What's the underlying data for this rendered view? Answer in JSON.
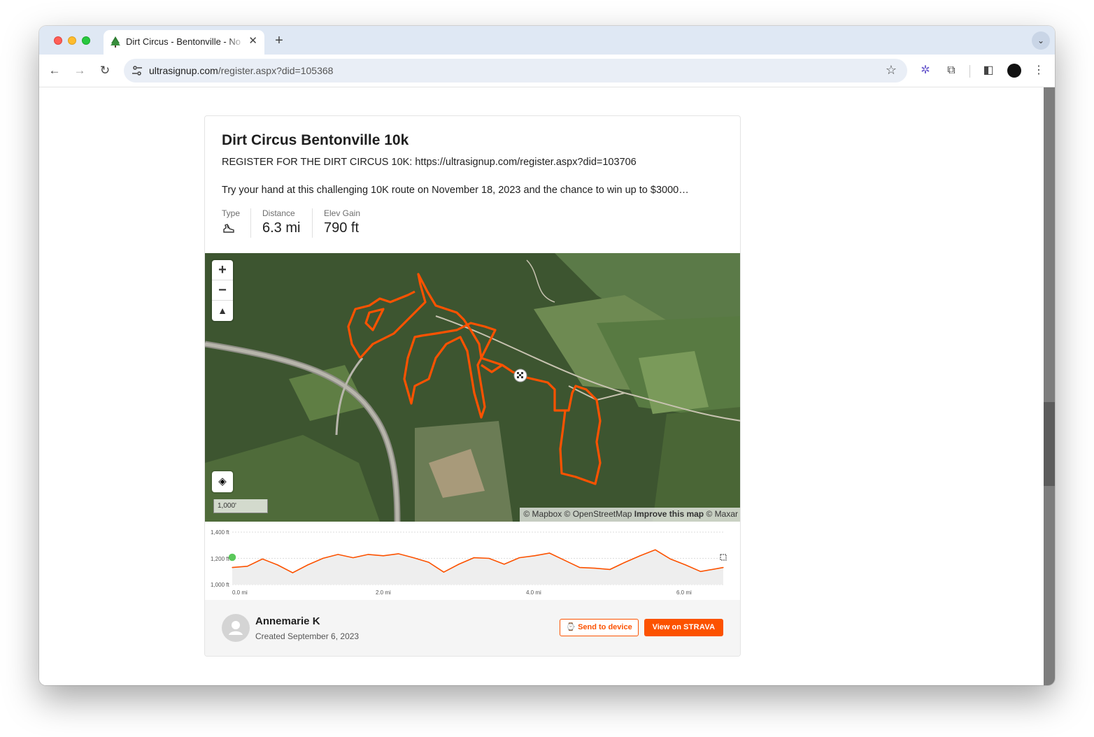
{
  "browser": {
    "tab_title": "Dirt Circus - Bentonville - No",
    "tab_close": "✕",
    "new_tab": "+",
    "tab_menu": "⌄",
    "url_domain": "ultrasignup.com",
    "url_path": "/register.aspx?did=105368",
    "icons": [
      "back-icon",
      "forward-icon",
      "reload-icon",
      "site-settings-icon",
      "bookmark-star-icon",
      "extension-puzzle-icon",
      "sidebar-icon",
      "profile-avatar",
      "more-menu-icon"
    ]
  },
  "route": {
    "title": "Dirt Circus Bentonville 10k",
    "register_line": "REGISTER FOR THE DIRT CIRCUS 10K: https://ultrasignup.com/register.aspx?did=103706",
    "description": "Try your hand at this challenging 10K route on November 18, 2023 and the chance to win up to $3000…",
    "stats": {
      "type_label": "Type",
      "type_icon": "run-shoe-icon",
      "distance_label": "Distance",
      "distance_value": "6.3 mi",
      "elev_label": "Elev Gain",
      "elev_value": "790 ft"
    }
  },
  "map": {
    "zoom_in": "+",
    "zoom_out": "−",
    "compass": "▲",
    "layers_icon": "layers-icon",
    "scale": "1,000'",
    "attrib_mapbox": "© Mapbox © OpenStreetMap",
    "attrib_improve": "Improve this map",
    "attrib_maxar": "© Maxar",
    "route_color": "#fc5200"
  },
  "chart_data": {
    "type": "area",
    "x_unit": "mi",
    "y_unit": "ft",
    "xlim": [
      0,
      6.5
    ],
    "ylim": [
      1000,
      1400
    ],
    "y_ticks": [
      "1,400 ft",
      "1,200 ft",
      "1,000 ft"
    ],
    "x_ticks": [
      "0.0 mi",
      "2.0 mi",
      "4.0 mi",
      "6.0 mi"
    ],
    "x": [
      0.0,
      0.2,
      0.4,
      0.6,
      0.8,
      1.0,
      1.2,
      1.4,
      1.6,
      1.8,
      2.0,
      2.2,
      2.4,
      2.6,
      2.8,
      3.0,
      3.2,
      3.4,
      3.6,
      3.8,
      4.0,
      4.2,
      4.4,
      4.6,
      4.8,
      5.0,
      5.2,
      5.4,
      5.6,
      5.8,
      6.0,
      6.2,
      6.5
    ],
    "y": [
      1130,
      1140,
      1195,
      1150,
      1090,
      1150,
      1200,
      1230,
      1205,
      1230,
      1220,
      1235,
      1205,
      1170,
      1095,
      1155,
      1205,
      1200,
      1155,
      1205,
      1220,
      1240,
      1185,
      1130,
      1125,
      1115,
      1170,
      1220,
      1265,
      1195,
      1150,
      1100,
      1130
    ],
    "series_color": "#fc5200"
  },
  "footer": {
    "user_name": "Annemarie K",
    "created": "Created September 6, 2023",
    "send_label": "Send to device",
    "strava_view": "View on",
    "strava_brand": "STRAVA"
  }
}
